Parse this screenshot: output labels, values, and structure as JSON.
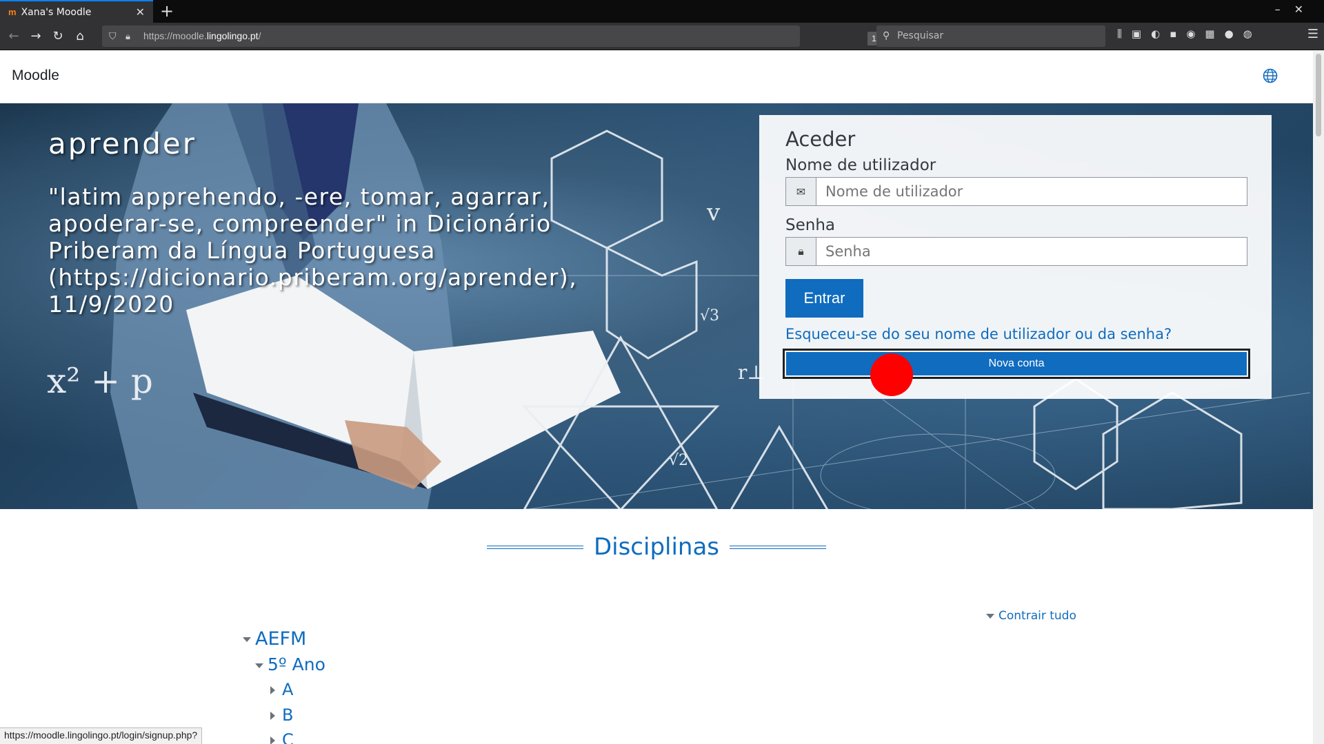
{
  "browser": {
    "tab_title": "Xana's Moodle",
    "tab_favicon": "m",
    "url_prefix": "https://moodle.",
    "url_host": "lingolingo.pt",
    "url_suffix": "/",
    "zoom": "110%",
    "search_placeholder": "Pesquisar",
    "status_url": "https://moodle.lingolingo.pt/login/signup.php?"
  },
  "site": {
    "brand": "Moodle"
  },
  "hero": {
    "title": "aprender",
    "text": "\"latim apprehendo, -ere, tomar, agarrar, apoderar-se, compreender\" in Dicionário Priberam da Língua Portuguesa (https://dicionario.priberam.org/aprender), 11/9/2020"
  },
  "login": {
    "title": "Aceder",
    "username_label": "Nome de utilizador",
    "username_placeholder": "Nome de utilizador",
    "password_label": "Senha",
    "password_placeholder": "Senha",
    "submit_label": "Entrar",
    "forgot_label": "Esqueceu-se do seu nome de utilizador ou da senha?",
    "signup_label": "Nova conta"
  },
  "courses": {
    "heading": "Disciplinas",
    "collapse_all": "Contrair tudo",
    "categories": [
      {
        "name": "AEFM"
      },
      {
        "name": "5º Ano"
      },
      {
        "name": "A"
      },
      {
        "name": "B"
      },
      {
        "name": "C"
      }
    ]
  },
  "colors": {
    "primary": "#0f6cbf",
    "cursor_marker": "#ff0000"
  }
}
